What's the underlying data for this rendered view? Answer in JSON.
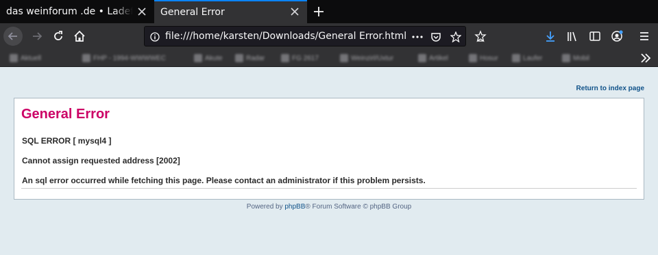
{
  "browser": {
    "tabs": [
      {
        "title": "das weinforum .de • Ladefehler",
        "active": false
      },
      {
        "title": "General Error",
        "active": true
      }
    ],
    "url": "file:///home/karsten/Downloads/General Error.html",
    "bookmarks": [
      "Aktuell",
      "FHP - 1994-WWWWEC",
      "Akute",
      "Radar",
      "FG 2617",
      "Weinzirl/Uxtur",
      "Artikel",
      "Hosur",
      "Laufer",
      "Mobil"
    ],
    "colors": {
      "accent": "#0a84ff",
      "tabbar": "#0c0c0d",
      "toolbar": "#323234"
    }
  },
  "page": {
    "return_link": "Return to index page",
    "title": "General Error",
    "lines": [
      "SQL ERROR [ mysql4 ]",
      "Cannot assign requested address [2002]",
      "An sql error occurred while fetching this page. Please contact an administrator if this problem persists."
    ],
    "footer": {
      "prefix": "Powered by ",
      "link": "phpBB",
      "suffix": "® Forum Software © phpBB Group"
    },
    "colors": {
      "title": "#cc0066",
      "link": "#105289",
      "background": "#e1ebf0"
    }
  }
}
